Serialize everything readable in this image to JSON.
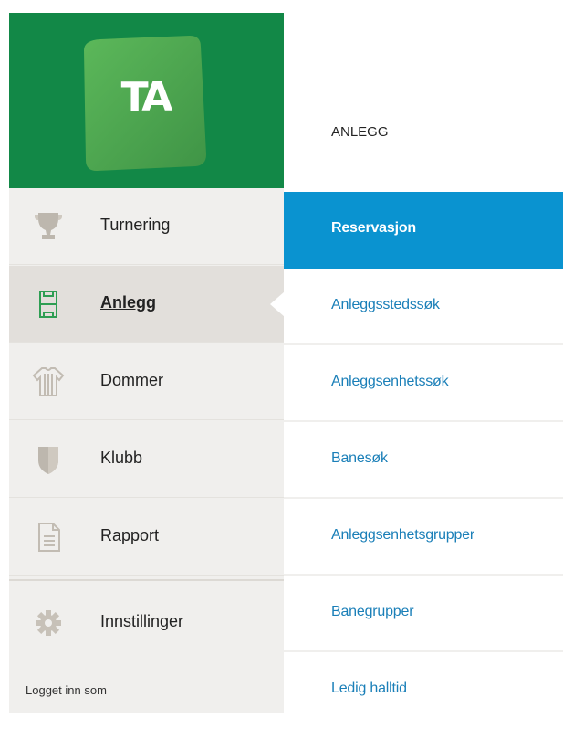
{
  "logo": {
    "text": "TA",
    "tile_color": "#4fa552",
    "bg_color": "#128847"
  },
  "sidebar": {
    "items": [
      {
        "label": "Turnering",
        "icon": "trophy-icon"
      },
      {
        "label": "Anlegg",
        "icon": "field-icon",
        "active": true
      },
      {
        "label": "Dommer",
        "icon": "referee-shirt-icon"
      },
      {
        "label": "Klubb",
        "icon": "shield-icon"
      },
      {
        "label": "Rapport",
        "icon": "document-icon"
      },
      {
        "label": "Innstillinger",
        "icon": "gear-icon"
      }
    ],
    "logged_in_text": "Logget inn som"
  },
  "submenu": {
    "title": "ANLEGG",
    "items": [
      {
        "label": "Reservasjon",
        "selected": true
      },
      {
        "label": "Anleggsstedssøk"
      },
      {
        "label": "Anleggsenhetssøk"
      },
      {
        "label": "Banesøk"
      },
      {
        "label": "Anleggsenhetsgrupper"
      },
      {
        "label": "Banegrupper"
      },
      {
        "label": "Ledig halltid"
      }
    ],
    "accent_color": "#0a93d0",
    "link_color": "#1a7fb8"
  }
}
